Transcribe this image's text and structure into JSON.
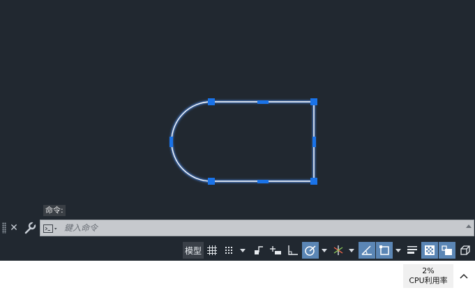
{
  "colors": {
    "canvas_bg": "#212830",
    "geometry": "#ffffff",
    "geometry_glow": "#7fb0ff",
    "grip": "#1a73e8",
    "active_toggle": "#5b86b5"
  },
  "canvas": {
    "selected_object": "closed polyline with arc (selected, grips shown)"
  },
  "command": {
    "history_line": "命令:",
    "placeholder": "鍵入命令",
    "close_icon": "close-icon",
    "settings_icon": "wrench-icon",
    "prompt_icon": "command-prompt-icon"
  },
  "status": {
    "model_label": "模型",
    "toggles": [
      {
        "name": "grid-display",
        "icon": "grid-icon",
        "active": false
      },
      {
        "name": "snap-mode",
        "icon": "snap-dots-icon",
        "active": false
      },
      {
        "name": "infer-constraints",
        "icon": "infer-constraints-icon",
        "active": false
      },
      {
        "name": "dynamic-input",
        "icon": "dynamic-input-icon",
        "active": false
      },
      {
        "name": "ortho-mode",
        "icon": "ortho-icon",
        "active": false
      },
      {
        "name": "polar-tracking",
        "icon": "polar-tracking-icon",
        "active": true
      },
      {
        "name": "isodraft",
        "icon": "isodraft-icon",
        "active": false
      },
      {
        "name": "object-snap-tracking",
        "icon": "snap-tracking-icon",
        "active": true
      },
      {
        "name": "object-snap",
        "icon": "object-snap-icon",
        "active": true
      },
      {
        "name": "lineweight",
        "icon": "lineweight-icon",
        "active": false
      },
      {
        "name": "transparency",
        "icon": "transparency-icon",
        "active": true
      },
      {
        "name": "selection-cycling",
        "icon": "selection-cycling-icon",
        "active": true
      },
      {
        "name": "3d-object-snap",
        "icon": "3d-osnap-icon",
        "active": false
      }
    ]
  },
  "taskbar": {
    "cpu_value": "2%",
    "cpu_label": "CPU利用率",
    "tray_icon": "chevron-up-icon"
  }
}
